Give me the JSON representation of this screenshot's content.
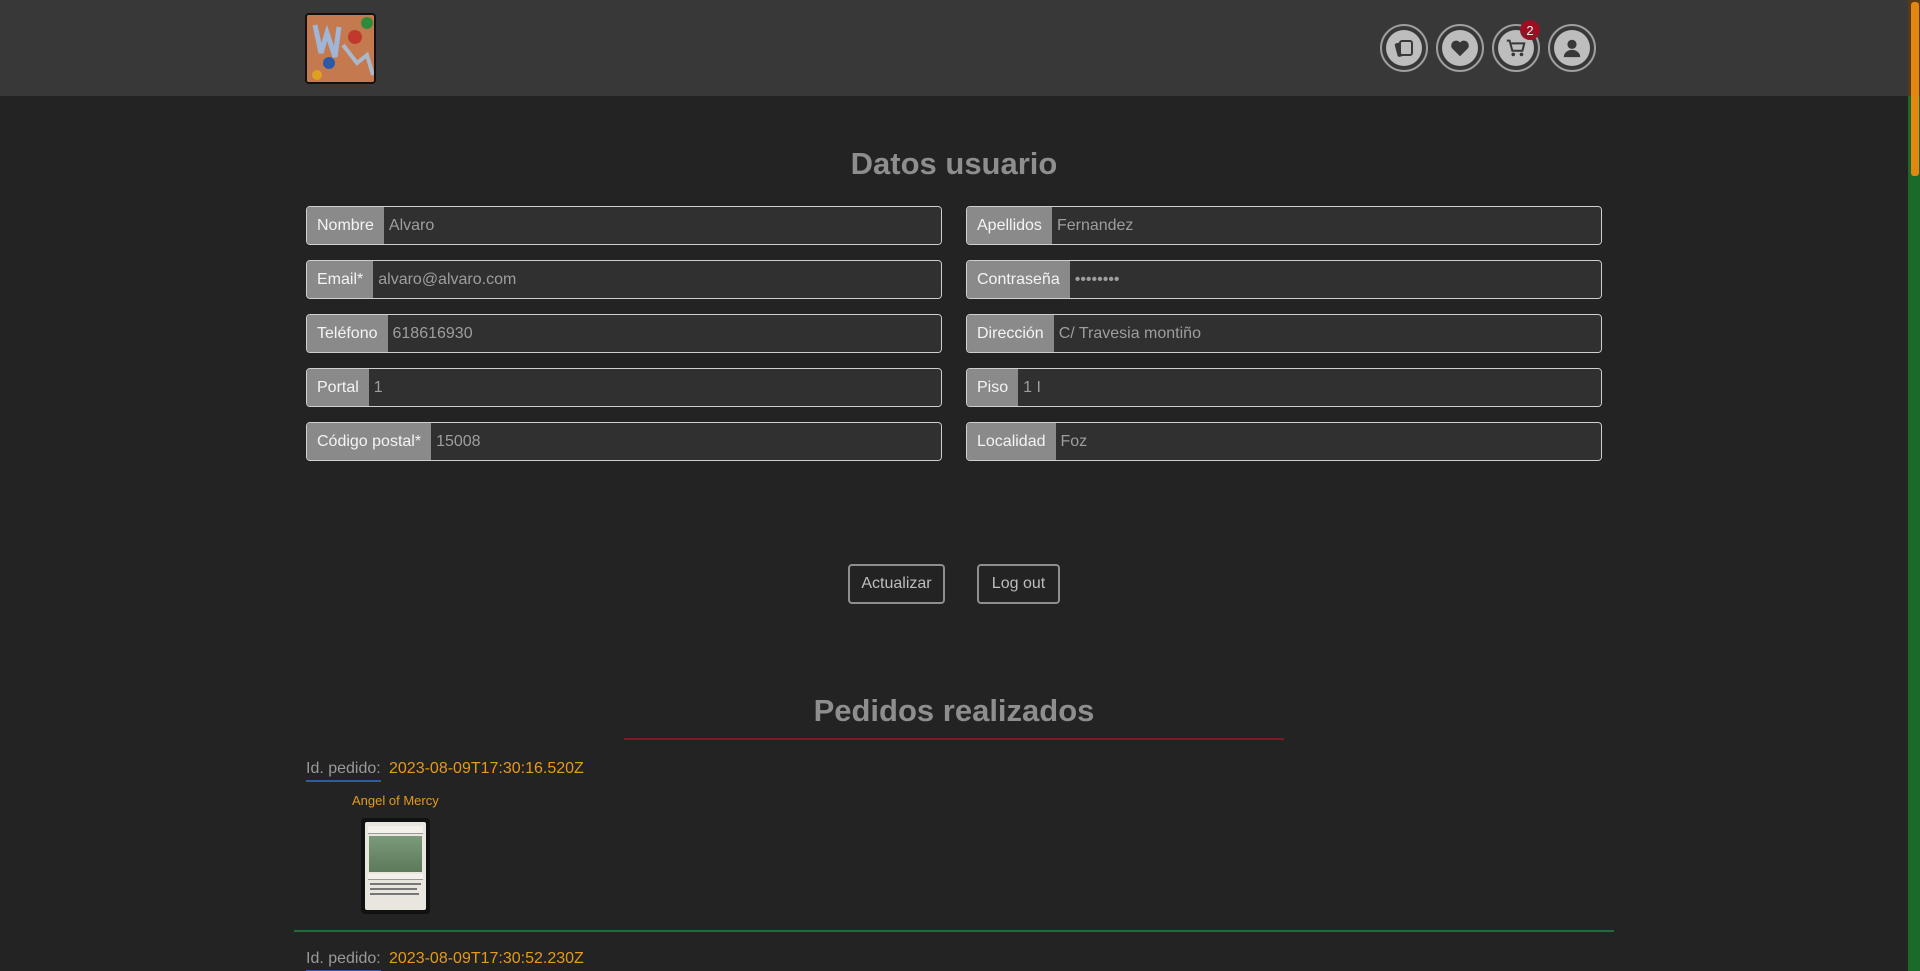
{
  "header": {
    "logo_alt": "logo",
    "nav": {
      "cards_icon": "cards-icon",
      "favorites_icon": "heart-icon",
      "cart_icon": "cart-icon",
      "cart_count": "2",
      "user_icon": "user-icon"
    }
  },
  "user_section": {
    "title": "Datos usuario",
    "fields": {
      "nombre": {
        "label": "Nombre",
        "value": "Alvaro"
      },
      "apellidos": {
        "label": "Apellidos",
        "value": "Fernandez"
      },
      "email": {
        "label": "Email*",
        "value": "alvaro@alvaro.com"
      },
      "password": {
        "label": "Contraseña",
        "value": "••••••••"
      },
      "telefono": {
        "label": "Teléfono",
        "value": "618616930"
      },
      "direccion": {
        "label": "Dirección",
        "value": "C/ Travesia montiño"
      },
      "portal": {
        "label": "Portal",
        "value": "1"
      },
      "piso": {
        "label": "Piso",
        "value": "1 I"
      },
      "codigo_postal": {
        "label": "Código postal*",
        "value": "15008"
      },
      "localidad": {
        "label": "Localidad",
        "value": "Foz"
      }
    },
    "buttons": {
      "update": "Actualizar",
      "logout": "Log out"
    }
  },
  "orders_section": {
    "title": "Pedidos realizados",
    "orders": [
      {
        "label": "Id. pedido:",
        "id": "2023-08-09T17:30:16.520Z",
        "product": "Angel of Mercy"
      },
      {
        "label": "Id. pedido:",
        "id": "2023-08-09T17:30:52.230Z"
      }
    ]
  },
  "colors": {
    "background": "#232323",
    "header": "#383838",
    "accent_orange": "#e59a1a",
    "badge_red": "#9a1022"
  }
}
